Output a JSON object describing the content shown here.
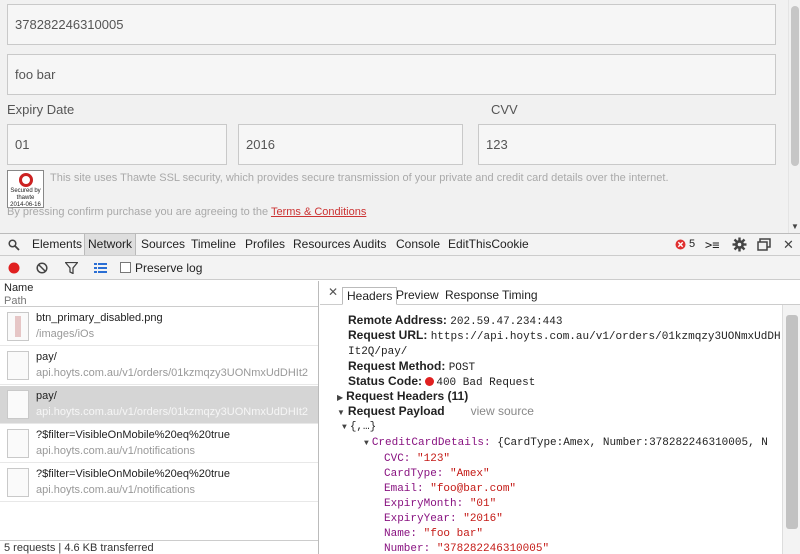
{
  "page": {
    "card_number": "378282246310005",
    "name_on_card": "foo bar",
    "expiry_label": "Expiry Date",
    "cvv_label": "CVV",
    "expiry_month": "01",
    "expiry_year": "2016",
    "cvv": "123",
    "seal_text": "Secured by thawte",
    "seal_date": "2014-06-16",
    "ssl_text": "This site uses Thawte SSL security, which provides secure transmission of your private and credit card details over the internet.",
    "terms_prefix": "By pressing confirm purchase you are agreeing to the ",
    "terms_link": "Terms & Conditions"
  },
  "devtools": {
    "tabs": [
      "Elements",
      "Network",
      "Sources",
      "Timeline",
      "Profiles",
      "Resources",
      "Audits",
      "Console",
      "EditThisCookie"
    ],
    "active_tab": "Network",
    "error_count": "5",
    "preserve_log_label": "Preserve log",
    "list": {
      "col_name": "Name",
      "col_path": "Path",
      "rows": [
        {
          "name": "btn_primary_disabled.png",
          "path": "/images/iOs"
        },
        {
          "name": "pay/",
          "path": "api.hoyts.com.au/v1/orders/01kzmqzy3UONmxUdDHIt2"
        },
        {
          "name": "pay/",
          "path": "api.hoyts.com.au/v1/orders/01kzmqzy3UONmxUdDHIt2"
        },
        {
          "name": "?$filter=VisibleOnMobile%20eq%20true",
          "path": "api.hoyts.com.au/v1/notifications"
        },
        {
          "name": "?$filter=VisibleOnMobile%20eq%20true",
          "path": "api.hoyts.com.au/v1/notifications"
        }
      ],
      "footer": "5 requests | 4.6 KB transferred"
    },
    "detail": {
      "tabs": [
        "Headers",
        "Preview",
        "Response",
        "Timing"
      ],
      "remote_address_label": "Remote Address:",
      "remote_address": "202.59.47.234:443",
      "request_url_label": "Request URL:",
      "request_url_line1": "https://api.hoyts.com.au/v1/orders/01kzmqzy3UONmxUdDH",
      "request_url_line2": "It2Q/pay/",
      "request_method_label": "Request Method:",
      "request_method": "POST",
      "status_code_label": "Status Code:",
      "status_code": "400 Bad Request",
      "request_headers_label": "Request Headers (11)",
      "request_payload_label": "Request Payload",
      "view_source": "view source",
      "payload_root": "{,…}",
      "ccd_key": "CreditCardDetails:",
      "ccd_summary": "{CardType:Amex, Number:378282246310005, N",
      "fields": [
        {
          "key": "CVC:",
          "value": "\"123\""
        },
        {
          "key": "CardType:",
          "value": "\"Amex\""
        },
        {
          "key": "Email:",
          "value": "\"foo@bar.com\""
        },
        {
          "key": "ExpiryMonth:",
          "value": "\"01\""
        },
        {
          "key": "ExpiryYear:",
          "value": "\"2016\""
        },
        {
          "key": "Name:",
          "value": "\"foo bar\""
        },
        {
          "key": "Number:",
          "value": "\"378282246310005\""
        }
      ]
    }
  }
}
